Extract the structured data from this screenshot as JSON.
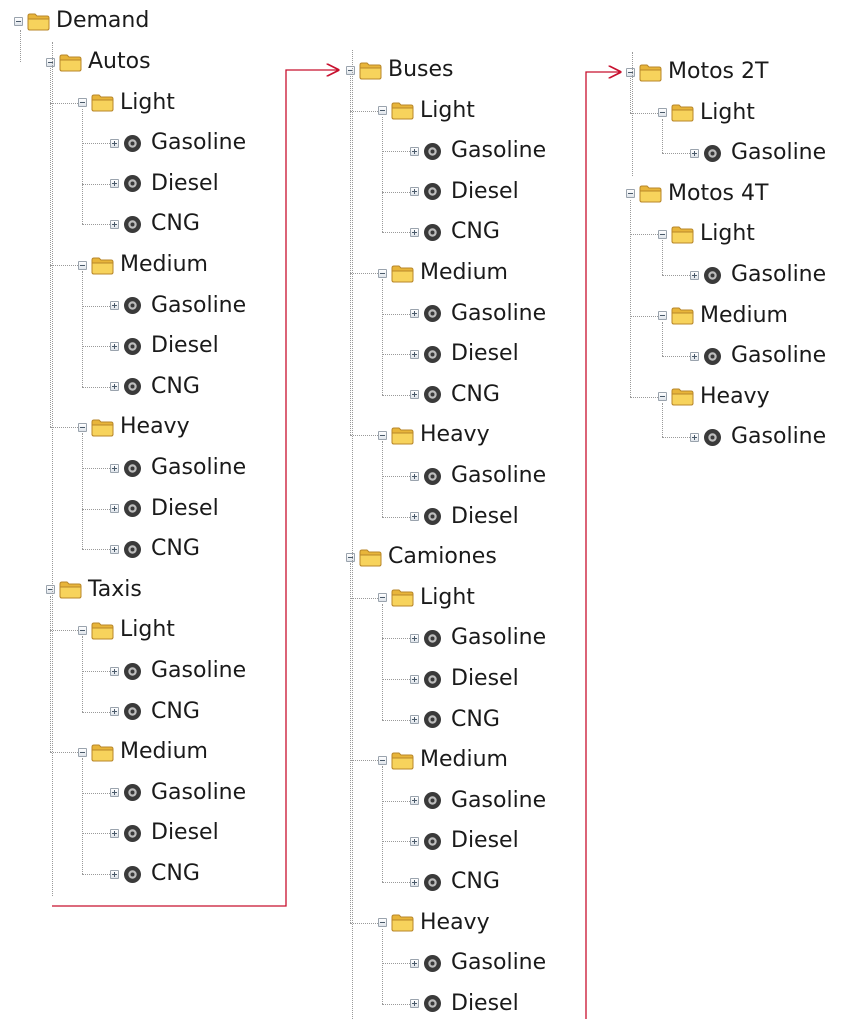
{
  "tree": {
    "demand_label": "Demand",
    "columns": [
      {
        "categories": [
          {
            "label": "Autos",
            "groups": [
              {
                "label": "Light",
                "fuels": [
                  "Gasoline",
                  "Diesel",
                  "CNG"
                ]
              },
              {
                "label": "Medium",
                "fuels": [
                  "Gasoline",
                  "Diesel",
                  "CNG"
                ]
              },
              {
                "label": "Heavy",
                "fuels": [
                  "Gasoline",
                  "Diesel",
                  "CNG"
                ]
              }
            ]
          },
          {
            "label": "Taxis",
            "groups": [
              {
                "label": "Light",
                "fuels": [
                  "Gasoline",
                  "CNG"
                ]
              },
              {
                "label": "Medium",
                "fuels": [
                  "Gasoline",
                  "Diesel",
                  "CNG"
                ]
              }
            ]
          }
        ]
      },
      {
        "categories": [
          {
            "label": "Buses",
            "groups": [
              {
                "label": "Light",
                "fuels": [
                  "Gasoline",
                  "Diesel",
                  "CNG"
                ]
              },
              {
                "label": "Medium",
                "fuels": [
                  "Gasoline",
                  "Diesel",
                  "CNG"
                ]
              },
              {
                "label": "Heavy",
                "fuels": [
                  "Gasoline",
                  "Diesel"
                ]
              }
            ]
          },
          {
            "label": "Camiones",
            "groups": [
              {
                "label": "Light",
                "fuels": [
                  "Gasoline",
                  "Diesel",
                  "CNG"
                ]
              },
              {
                "label": "Medium",
                "fuels": [
                  "Gasoline",
                  "Diesel",
                  "CNG"
                ]
              },
              {
                "label": "Heavy",
                "fuels": [
                  "Gasoline",
                  "Diesel"
                ]
              }
            ]
          }
        ]
      },
      {
        "categories": [
          {
            "label": "Motos 2T",
            "groups": [
              {
                "label": "Light",
                "fuels": [
                  "Gasoline"
                ]
              }
            ]
          },
          {
            "label": "Motos 4T",
            "groups": [
              {
                "label": "Light",
                "fuels": [
                  "Gasoline"
                ]
              },
              {
                "label": "Medium",
                "fuels": [
                  "Gasoline"
                ]
              },
              {
                "label": "Heavy",
                "fuels": [
                  "Gasoline"
                ]
              }
            ]
          }
        ]
      }
    ]
  },
  "icons": {
    "folder": "folder-icon",
    "technology": "technology-gear-icon",
    "collapse": "collapse-minus-icon",
    "expand": "expand-plus-icon"
  },
  "colors": {
    "folder_fill": "#f7d35c",
    "folder_tab": "#e8b53a",
    "tech_icon": "#3a3a3a",
    "connector_arrow": "#c8102e",
    "tree_lines": "#9a9a9a"
  }
}
